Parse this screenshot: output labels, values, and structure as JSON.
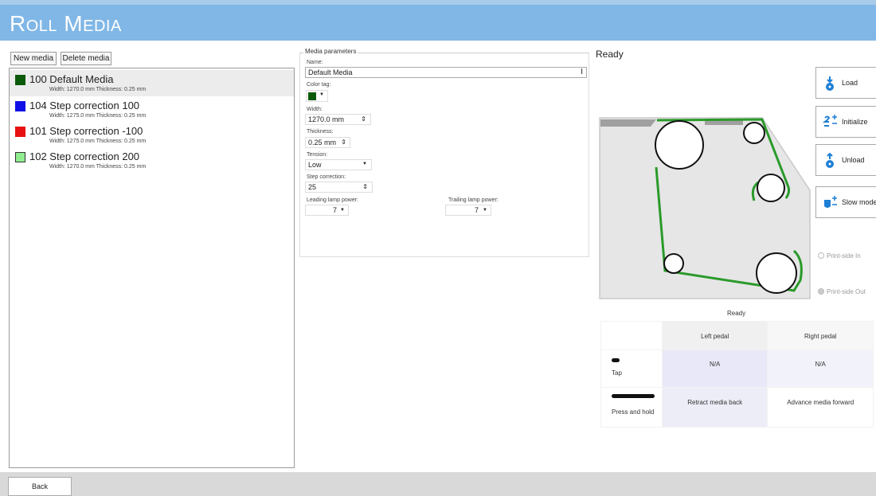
{
  "app": {
    "title": "Roll Media"
  },
  "toolbar": {
    "new_media": "New media",
    "delete_media": "Delete media"
  },
  "media": [
    {
      "title": "100 Default Media",
      "sub": "Width: 1270.0 mm  Thickness: 0.25 mm",
      "color": "#0a5a0a"
    },
    {
      "title": "104 Step correction 100",
      "sub": "Width: 1275.0 mm  Thickness: 0.25 mm",
      "color": "#1010e6"
    },
    {
      "title": "101 Step correction -100",
      "sub": "Width: 1275.0 mm  Thickness: 0.25 mm",
      "color": "#e81010"
    },
    {
      "title": "102 Step correction 200",
      "sub": "Width: 1270.0 mm  Thickness: 0.25 mm",
      "color": "#90ee90"
    }
  ],
  "params": {
    "legend": "Media parameters",
    "name_label": "Name:",
    "name_value": "Default Media",
    "color_label": "Color tag:",
    "color_value": "#0a5a0a",
    "width_label": "Width:",
    "width_value": "1270.0 mm",
    "thickness_label": "Thickness:",
    "thickness_value": "0.25 mm",
    "tension_label": "Tension:",
    "tension_value": "Low",
    "step_label": "Step correction:",
    "step_value": "25",
    "leading_label": "Leading lamp power:",
    "leading_value": "7",
    "trailing_label": "Trailing lamp power:",
    "trailing_value": "7"
  },
  "status": {
    "title": "Ready",
    "pedal_status": "Ready"
  },
  "side_buttons": {
    "load": "Load",
    "initialize": "Initialize",
    "unload": "Unload",
    "slow_mode": "Slow mode"
  },
  "radios": {
    "in": "Print-side In",
    "out": "Print-side Out"
  },
  "pedals": {
    "left": "Left pedal",
    "right": "Right pedal",
    "tap": "Tap",
    "tap_left": "N/A",
    "tap_right": "N/A",
    "hold": "Press and hold",
    "hold_left": "Retract media back",
    "hold_right": "Advance media forward"
  },
  "footer": {
    "back": "Back"
  }
}
